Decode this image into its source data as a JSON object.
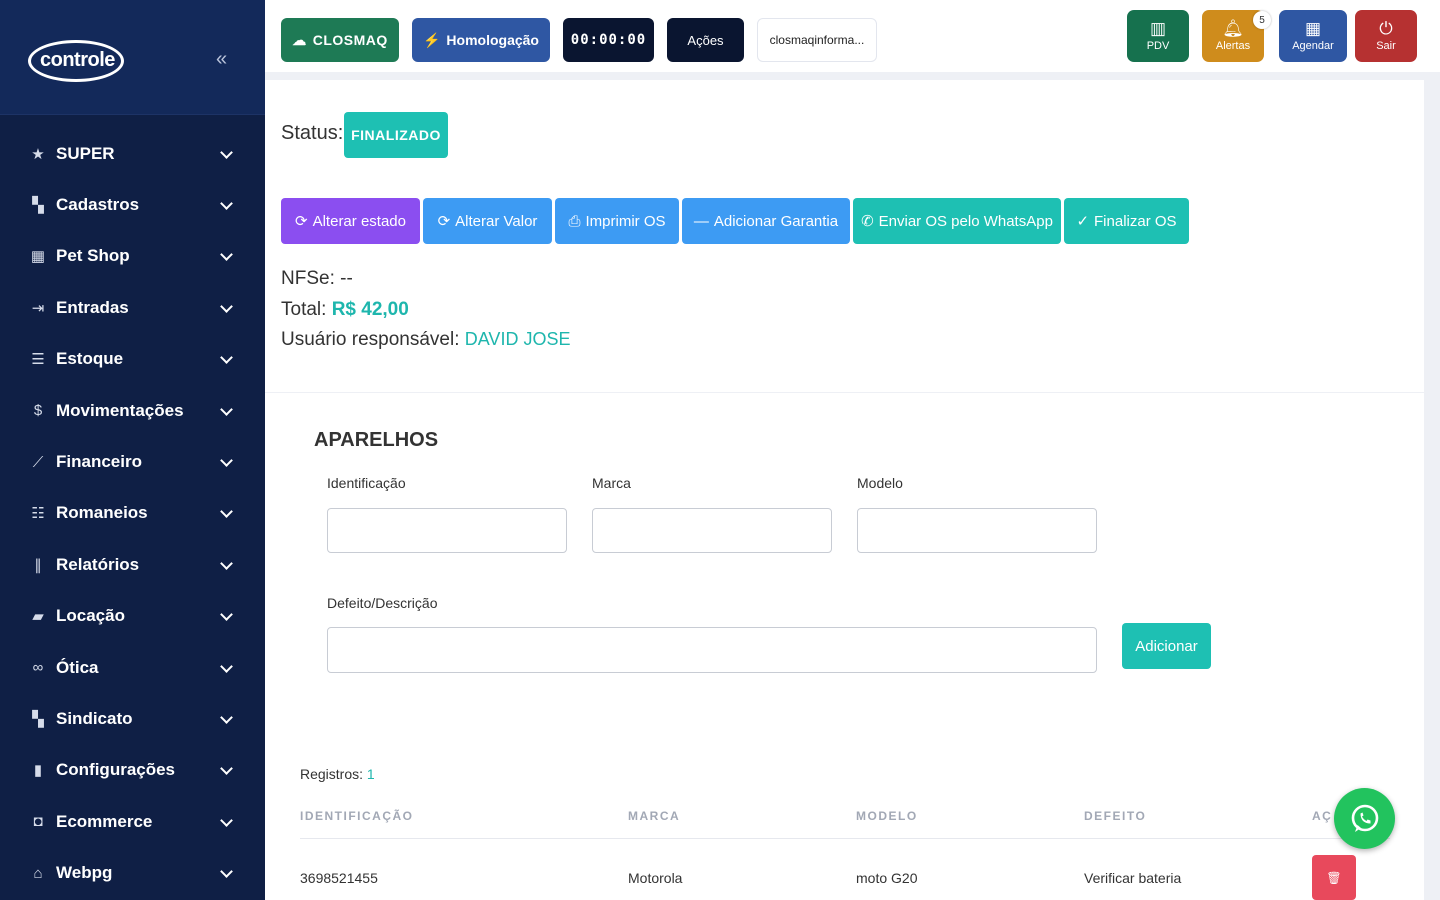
{
  "sidebar": {
    "logo_text": "controle",
    "collapse_glyph": "«",
    "items": [
      {
        "label": "SUPER",
        "icon": "star-icon"
      },
      {
        "label": "Cadastros",
        "icon": "grid-icon"
      },
      {
        "label": "Pet Shop",
        "icon": "store-icon"
      },
      {
        "label": "Entradas",
        "icon": "login-icon"
      },
      {
        "label": "Estoque",
        "icon": "list-icon"
      },
      {
        "label": "Movimentações",
        "icon": "dollar-icon"
      },
      {
        "label": "Financeiro",
        "icon": "chart-icon"
      },
      {
        "label": "Romaneios",
        "icon": "checklist-icon"
      },
      {
        "label": "Relatórios",
        "icon": "books-icon"
      },
      {
        "label": "Locação",
        "icon": "truck-icon"
      },
      {
        "label": "Ótica",
        "icon": "glasses-icon"
      },
      {
        "label": "Sindicato",
        "icon": "grid-icon"
      },
      {
        "label": "Configurações",
        "icon": "clipboard-icon"
      },
      {
        "label": "Ecommerce",
        "icon": "bookmark-icon"
      },
      {
        "label": "Webpg",
        "icon": "basket-icon"
      }
    ]
  },
  "topbar": {
    "closmaq": "CLOSMAQ",
    "homologacao": "Homologação",
    "timer": "00:00:00",
    "acoes": "Ações",
    "user": "closmaqinforma...",
    "pdv": "PDV",
    "alertas": "Alertas",
    "alert_count": "5",
    "agendar": "Agendar",
    "sair": "Sair"
  },
  "status": {
    "label": "Status:",
    "value": "FINALIZADO"
  },
  "actions": {
    "alterar_estado": "Alterar estado",
    "alterar_valor": "Alterar Valor",
    "imprimir": "Imprimir OS",
    "garantia": "Adicionar Garantia",
    "whatsapp": "Enviar OS pelo WhatsApp",
    "finalizar": "Finalizar OS"
  },
  "info": {
    "nfse_label": "NFSe:",
    "nfse_value": "--",
    "total_label": "Total:",
    "total_value": "R$ 42,00",
    "resp_label": "Usuário responsável:",
    "resp_value": "DAVID JOSE"
  },
  "aparelhos": {
    "title": "APARELHOS",
    "fields": {
      "identificacao": {
        "label": "Identificação",
        "value": ""
      },
      "marca": {
        "label": "Marca",
        "value": ""
      },
      "modelo": {
        "label": "Modelo",
        "value": ""
      },
      "defeito": {
        "label": "Defeito/Descrição",
        "value": ""
      }
    },
    "add_button": "Adicionar",
    "registros_label": "Registros:",
    "registros_count": "1",
    "columns": [
      "IDENTIFICAÇÃO",
      "MARCA",
      "MODELO",
      "DEFEITO",
      "AÇ"
    ],
    "rows": [
      {
        "identificacao": "3698521455",
        "marca": "Motorola",
        "modelo": "moto G20",
        "defeito": "Verificar bateria"
      }
    ]
  },
  "colors": {
    "sidebar_bg": "#0f1f45",
    "accent_teal": "#1ec0b3",
    "blue": "#3d9bf3",
    "purple": "#8b4ef0",
    "danger": "#e8495c",
    "whatsapp": "#22c35e"
  }
}
